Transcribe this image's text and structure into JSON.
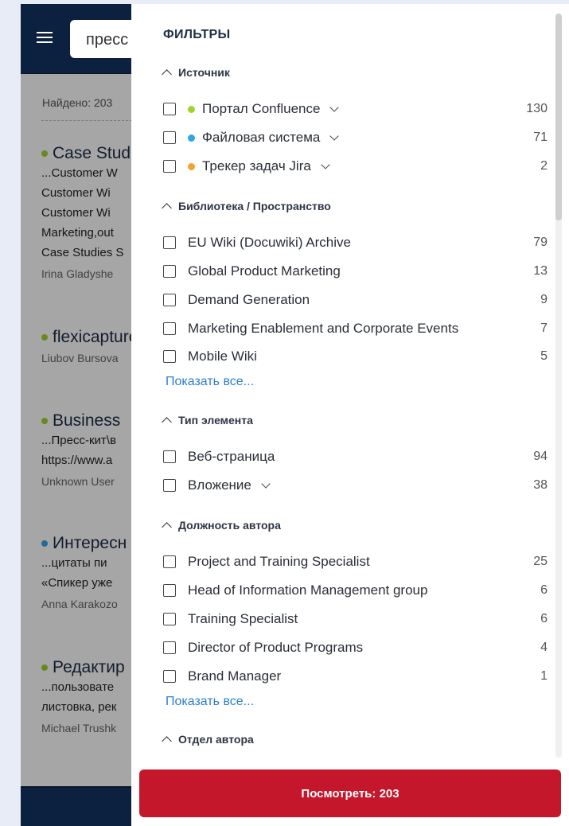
{
  "background": {
    "search_value": "пресс",
    "found_text": "Найдено: 203",
    "results": [
      {
        "title": "Case Studies",
        "dot_color": "#a3d22c",
        "snippet": [
          "...Customer W",
          "Customer Wi",
          "Customer Wi",
          "Marketing,out",
          "Case Studies S"
        ],
        "author": "Irina Gladyshe"
      },
      {
        "title": "flexicapture",
        "dot_color": "#a3d22c",
        "snippet": [],
        "author": "Liubov Bursova"
      },
      {
        "title": "Business",
        "dot_color": "#a3d22c",
        "snippet": [
          "...Пресс-кит\\в",
          "https://www.a"
        ],
        "author": "Unknown User"
      },
      {
        "title": "Интересн",
        "dot_color": "#2ea6e8",
        "snippet": [
          "...цитаты пи",
          "«Спикер уже"
        ],
        "author": "Anna Karakozo"
      },
      {
        "title": "Редактир",
        "dot_color": "#a3d22c",
        "snippet": [
          "...пользовате",
          "листовка, рек"
        ],
        "author": "Michael Trushk"
      }
    ]
  },
  "filters": {
    "title": "ФИЛЬТРЫ",
    "sections": {
      "source": {
        "label": "Источник",
        "items": [
          {
            "label": "Портал Confluence",
            "count": "130",
            "dot": "#a3d22c"
          },
          {
            "label": "Файловая система",
            "count": "71",
            "dot": "#2ea6e8"
          },
          {
            "label": "Трекер задач Jira",
            "count": "2",
            "dot": "#f5a230"
          }
        ]
      },
      "library": {
        "label": "Библиотека / Пространство",
        "items": [
          {
            "label": "EU Wiki (Docuwiki) Archive",
            "count": "79"
          },
          {
            "label": "Global Product Marketing",
            "count": "13"
          },
          {
            "label": "Demand Generation",
            "count": "9"
          },
          {
            "label": "Marketing Enablement and Corporate Events",
            "count": "7"
          },
          {
            "label": "Mobile Wiki",
            "count": "5"
          }
        ],
        "show_all": "Показать все..."
      },
      "item_type": {
        "label": "Тип элемента",
        "items": [
          {
            "label": "Веб-страница",
            "count": "94"
          },
          {
            "label": "Вложение",
            "count": "38"
          }
        ]
      },
      "author_position": {
        "label": "Должность автора",
        "items": [
          {
            "label": "Project and Training Specialist",
            "count": "25"
          },
          {
            "label": "Head of Information Management group",
            "count": "6"
          },
          {
            "label": "Training Specialist",
            "count": "6"
          },
          {
            "label": "Director of Product Programs",
            "count": "4"
          },
          {
            "label": "Brand Manager",
            "count": "1"
          }
        ],
        "show_all": "Показать все..."
      },
      "author_department": {
        "label": "Отдел автора"
      }
    },
    "apply_label": "Посмотреть: 203"
  }
}
